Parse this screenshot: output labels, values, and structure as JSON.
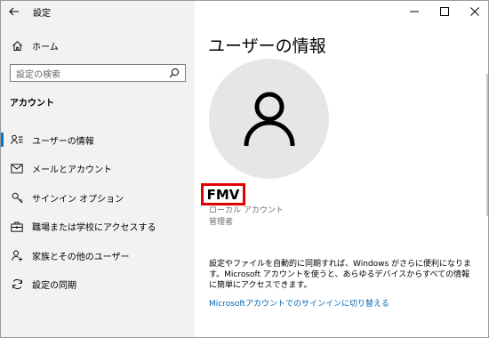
{
  "titlebar": {
    "back_icon": "back-arrow-icon",
    "app_title": "設定",
    "controls": {
      "minimize": "—",
      "maximize": "☐",
      "close": "✕"
    }
  },
  "sidebar": {
    "home_label": "ホーム",
    "search_placeholder": "設定の検索",
    "section_header": "アカウント",
    "items": [
      {
        "label": "ユーザーの情報",
        "icon": "user-info-icon",
        "active": true
      },
      {
        "label": "メールとアカウント",
        "icon": "mail-icon",
        "active": false
      },
      {
        "label": "サインイン オプション",
        "icon": "key-icon",
        "active": false
      },
      {
        "label": "職場または学校にアクセスする",
        "icon": "briefcase-icon",
        "active": false
      },
      {
        "label": "家族とその他のユーザー",
        "icon": "add-person-icon",
        "active": false
      },
      {
        "label": "設定の同期",
        "icon": "sync-icon",
        "active": false
      }
    ]
  },
  "main": {
    "page_title": "ユーザーの情報",
    "username": "FMV",
    "account_type": "ローカル アカウント",
    "account_role": "管理者",
    "description": "設定やファイルを自動的に同期すれば、Windows がさらに便利になります。Microsoft アカウントを使うと、あらゆるデバイスからすべての情報に簡単にアクセスできます。",
    "link_text": "Microsoftアカウントでのサインインに切り替える"
  },
  "colors": {
    "accent": "#0078d7",
    "link": "#0066b4",
    "highlight_border": "#e00000",
    "sidebar_bg": "#f2f2f2",
    "avatar_bg": "#e6e6e6"
  }
}
